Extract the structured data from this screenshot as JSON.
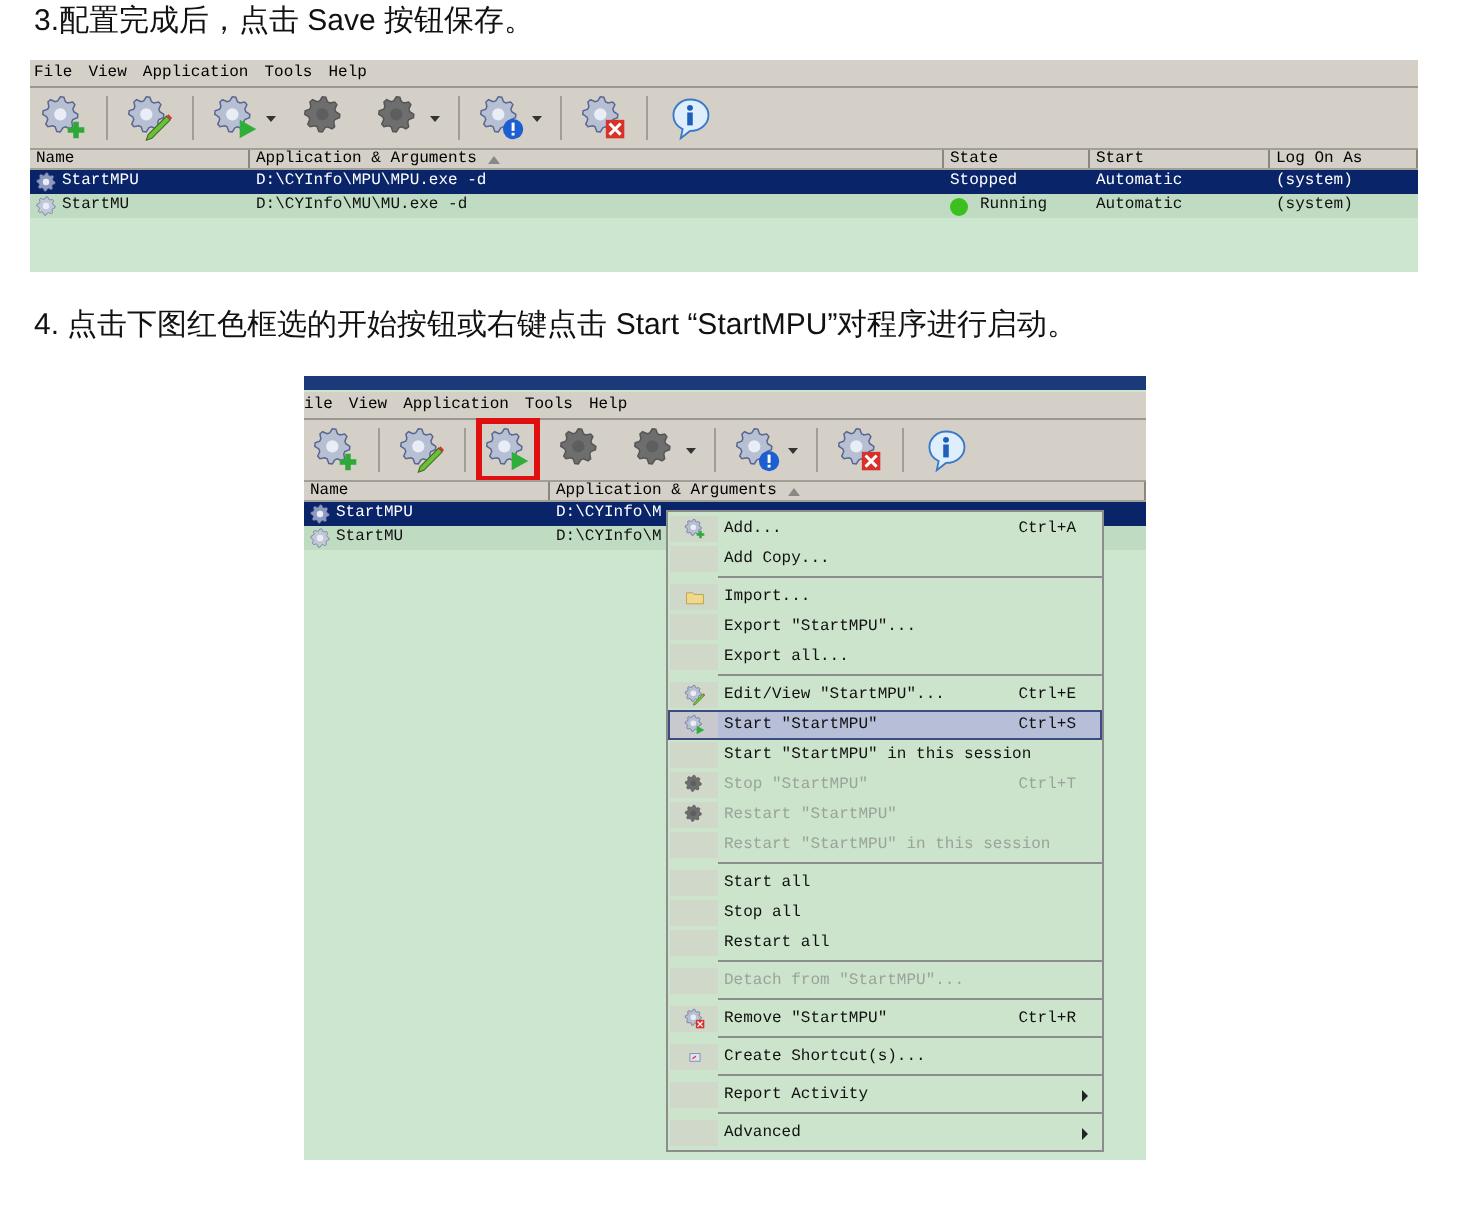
{
  "step_3": {
    "text": "3.配置完成后，点击 Save 按钮保存。"
  },
  "screenshot_1": {
    "menu_bar": [
      "File",
      "View",
      "Application",
      "Tools",
      "Help"
    ],
    "toolbar": [
      {
        "kind": "add"
      },
      {
        "kind": "separator"
      },
      {
        "kind": "edit"
      },
      {
        "kind": "separator"
      },
      {
        "kind": "start",
        "dropdown": true
      },
      {
        "kind": "stop",
        "disabled": true
      },
      {
        "kind": "restart",
        "disabled": true,
        "dropdown": true
      },
      {
        "kind": "separator"
      },
      {
        "kind": "status",
        "dropdown": true
      },
      {
        "kind": "separator"
      },
      {
        "kind": "remove"
      },
      {
        "kind": "separator"
      },
      {
        "kind": "about"
      }
    ],
    "columns": [
      {
        "label": "Name"
      },
      {
        "label": "Application & Arguments",
        "sorted": true
      },
      {
        "label": "State"
      },
      {
        "label": "Start"
      },
      {
        "label": "Log On As"
      }
    ],
    "rows": [
      {
        "selected": true,
        "cells": [
          "StartMPU",
          "D:\\CYInfo\\MPU\\MPU.exe -d",
          "Stopped",
          "Automatic",
          "(system)"
        ],
        "running": false
      },
      {
        "selected": false,
        "cells": [
          "StartMU",
          "D:\\CYInfo\\MU\\MU.exe -d",
          "Running",
          "Automatic",
          "(system)"
        ],
        "running": true
      }
    ]
  },
  "step_4": {
    "text": "4.  点击下图红色框选的开始按钮或右键点击  Start  “StartMPU”对程序进行启动。"
  },
  "screenshot_2": {
    "menu_bar": [
      "ile",
      "View",
      "Application",
      "Tools",
      "Help"
    ],
    "toolbar": [
      {
        "kind": "add"
      },
      {
        "kind": "separator"
      },
      {
        "kind": "edit"
      },
      {
        "kind": "separator"
      },
      {
        "kind": "start",
        "highlighted": true
      },
      {
        "kind": "stop",
        "disabled": true
      },
      {
        "kind": "restart",
        "disabled": true,
        "dropdown": true
      },
      {
        "kind": "separator"
      },
      {
        "kind": "status",
        "dropdown": true
      },
      {
        "kind": "separator"
      },
      {
        "kind": "remove"
      },
      {
        "kind": "separator"
      },
      {
        "kind": "about"
      }
    ],
    "columns": [
      {
        "label": "Name"
      },
      {
        "label": "Application & Arguments",
        "sorted": true
      }
    ],
    "rows": [
      {
        "selected": true,
        "cells": [
          "StartMPU",
          "D:\\CYInfo\\M"
        ]
      },
      {
        "selected": false,
        "cells": [
          "StartMU",
          "D:\\CYInfo\\M"
        ]
      }
    ],
    "context_menu": [
      {
        "kind": "item",
        "label": "Add...",
        "shortcut": "Ctrl+A",
        "disabled": false,
        "selected": false
      },
      {
        "kind": "item",
        "label": "Add Copy...",
        "disabled": false,
        "selected": false
      },
      {
        "kind": "separator"
      },
      {
        "kind": "item",
        "label": "Import...",
        "disabled": false,
        "selected": false
      },
      {
        "kind": "item",
        "label": "Export \"StartMPU\"...",
        "disabled": false,
        "selected": false
      },
      {
        "kind": "item",
        "label": "Export all...",
        "disabled": false,
        "selected": false
      },
      {
        "kind": "separator"
      },
      {
        "kind": "item",
        "label": "Edit/View \"StartMPU\"...",
        "shortcut": "Ctrl+E",
        "disabled": false,
        "selected": false
      },
      {
        "kind": "item",
        "label": "Start \"StartMPU\"",
        "shortcut": "Ctrl+S",
        "disabled": false,
        "selected": true
      },
      {
        "kind": "item",
        "label": "Start \"StartMPU\" in this session",
        "disabled": false,
        "selected": false
      },
      {
        "kind": "item",
        "label": "Stop \"StartMPU\"",
        "shortcut": "Ctrl+T",
        "disabled": true,
        "selected": false
      },
      {
        "kind": "item",
        "label": "Restart \"StartMPU\"",
        "disabled": true,
        "selected": false
      },
      {
        "kind": "item",
        "label": "Restart \"StartMPU\" in this session",
        "disabled": true,
        "selected": false
      },
      {
        "kind": "separator"
      },
      {
        "kind": "item",
        "label": "Start all",
        "disabled": false,
        "selected": false
      },
      {
        "kind": "item",
        "label": "Stop all",
        "disabled": false,
        "selected": false
      },
      {
        "kind": "item",
        "label": "Restart all",
        "disabled": false,
        "selected": false
      },
      {
        "kind": "separator"
      },
      {
        "kind": "item",
        "label": "Detach from \"StartMPU\"...",
        "disabled": true,
        "selected": false
      },
      {
        "kind": "separator"
      },
      {
        "kind": "item",
        "label": "Remove \"StartMPU\"",
        "shortcut": "Ctrl+R",
        "disabled": false,
        "selected": false
      },
      {
        "kind": "separator"
      },
      {
        "kind": "item",
        "label": "Create Shortcut(s)...",
        "disabled": false,
        "selected": false
      },
      {
        "kind": "separator"
      },
      {
        "kind": "item",
        "label": "Report Activity",
        "submenu": true,
        "disabled": false,
        "selected": false
      },
      {
        "kind": "separator"
      },
      {
        "kind": "item",
        "label": "Advanced",
        "submenu": true,
        "disabled": false,
        "selected": false
      }
    ]
  }
}
